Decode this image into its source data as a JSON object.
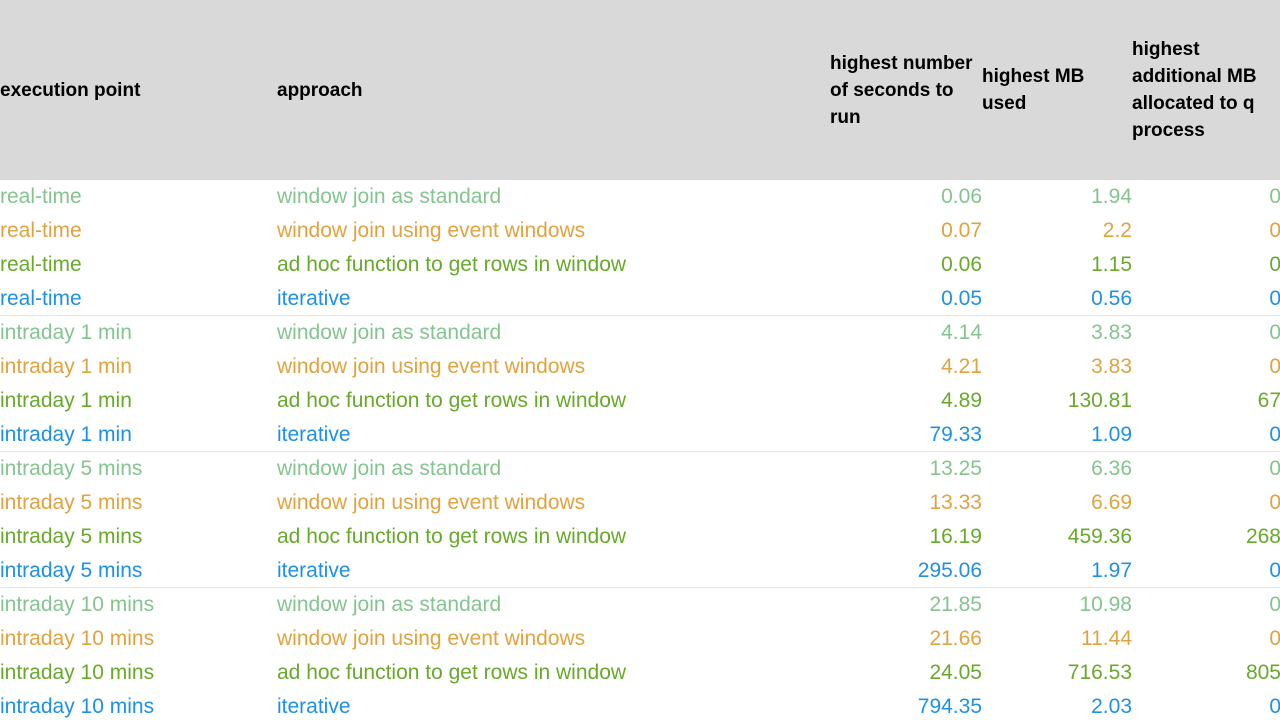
{
  "table": {
    "columns": [
      {
        "key": "execution_point",
        "label": "execution point",
        "align": "left"
      },
      {
        "key": "approach",
        "label": "approach",
        "align": "left"
      },
      {
        "key": "seconds",
        "label": "highest number of seconds to run",
        "align": "right"
      },
      {
        "key": "mb_used",
        "label": "highest MB used",
        "align": "right"
      },
      {
        "key": "mb_allocated",
        "label": "highest additional MB allocated to q process",
        "align": "right"
      }
    ],
    "header_background": "#d9d9d9",
    "header_text_color": "#000000",
    "row_background": "#ffffff",
    "separator_color": "#e6e6e6",
    "approach_colors": {
      "window join as standard": "#85c490",
      "window join using event windows": "#dfa33f",
      "ad hoc function to get rows in window": "#68a92c",
      "iterative": "#1f90e8"
    },
    "rows": [
      {
        "execution_point": "real-time",
        "approach": "window join as standard",
        "seconds": "0.06",
        "mb_used": "1.94",
        "mb_allocated": "0",
        "color_key": "k-standard",
        "group_end": false
      },
      {
        "execution_point": "real-time",
        "approach": "window join using event windows",
        "seconds": "0.07",
        "mb_used": "2.2",
        "mb_allocated": "0",
        "color_key": "k-event",
        "group_end": false
      },
      {
        "execution_point": "real-time",
        "approach": "ad hoc function to get rows in window",
        "seconds": "0.06",
        "mb_used": "1.15",
        "mb_allocated": "0",
        "color_key": "k-adhoc",
        "group_end": false
      },
      {
        "execution_point": "real-time",
        "approach": "iterative",
        "seconds": "0.05",
        "mb_used": "0.56",
        "mb_allocated": "0",
        "color_key": "k-iter",
        "group_end": true
      },
      {
        "execution_point": "intraday 1 min",
        "approach": "window join as standard",
        "seconds": "4.14",
        "mb_used": "3.83",
        "mb_allocated": "0",
        "color_key": "k-standard",
        "group_end": false
      },
      {
        "execution_point": "intraday 1 min",
        "approach": "window join using event windows",
        "seconds": "4.21",
        "mb_used": "3.83",
        "mb_allocated": "0",
        "color_key": "k-event",
        "group_end": false
      },
      {
        "execution_point": "intraday 1 min",
        "approach": "ad hoc function to get rows in window",
        "seconds": "4.89",
        "mb_used": "130.81",
        "mb_allocated": "67",
        "color_key": "k-adhoc",
        "group_end": false
      },
      {
        "execution_point": "intraday 1 min",
        "approach": "iterative",
        "seconds": "79.33",
        "mb_used": "1.09",
        "mb_allocated": "0",
        "color_key": "k-iter",
        "group_end": true
      },
      {
        "execution_point": "intraday 5 mins",
        "approach": "window join as standard",
        "seconds": "13.25",
        "mb_used": "6.36",
        "mb_allocated": "0",
        "color_key": "k-standard",
        "group_end": false
      },
      {
        "execution_point": "intraday 5 mins",
        "approach": "window join using event windows",
        "seconds": "13.33",
        "mb_used": "6.69",
        "mb_allocated": "0",
        "color_key": "k-event",
        "group_end": false
      },
      {
        "execution_point": "intraday 5 mins",
        "approach": "ad hoc function to get rows in window",
        "seconds": "16.19",
        "mb_used": "459.36",
        "mb_allocated": "268",
        "color_key": "k-adhoc",
        "group_end": false
      },
      {
        "execution_point": "intraday 5 mins",
        "approach": "iterative",
        "seconds": "295.06",
        "mb_used": "1.97",
        "mb_allocated": "0",
        "color_key": "k-iter",
        "group_end": true
      },
      {
        "execution_point": "intraday 10 mins",
        "approach": "window join as standard",
        "seconds": "21.85",
        "mb_used": "10.98",
        "mb_allocated": "0",
        "color_key": "k-standard",
        "group_end": false
      },
      {
        "execution_point": "intraday 10 mins",
        "approach": "window join using event windows",
        "seconds": "21.66",
        "mb_used": "11.44",
        "mb_allocated": "0",
        "color_key": "k-event",
        "group_end": false
      },
      {
        "execution_point": "intraday 10 mins",
        "approach": "ad hoc function to get rows in window",
        "seconds": "24.05",
        "mb_used": "716.53",
        "mb_allocated": "805",
        "color_key": "k-adhoc",
        "group_end": false
      },
      {
        "execution_point": "intraday 10 mins",
        "approach": "iterative",
        "seconds": "794.35",
        "mb_used": "2.03",
        "mb_allocated": "0",
        "color_key": "k-iter",
        "group_end": true
      }
    ]
  },
  "chart_data": {
    "type": "table",
    "title": "",
    "columns": [
      "execution point",
      "approach",
      "highest number of seconds to run",
      "highest MB used",
      "highest additional MB allocated to q process"
    ],
    "categories": [
      "real-time",
      "intraday 1 min",
      "intraday 5 mins",
      "intraday 10 mins"
    ],
    "series": [
      {
        "name": "window join as standard",
        "color": "#85c490",
        "seconds": [
          0.06,
          4.14,
          13.25,
          21.85
        ],
        "mb_used": [
          1.94,
          3.83,
          6.36,
          10.98
        ],
        "mb_allocated": [
          0,
          0,
          0,
          0
        ]
      },
      {
        "name": "window join using event windows",
        "color": "#dfa33f",
        "seconds": [
          0.07,
          4.21,
          13.33,
          21.66
        ],
        "mb_used": [
          2.2,
          3.83,
          6.69,
          11.44
        ],
        "mb_allocated": [
          0,
          0,
          0,
          0
        ]
      },
      {
        "name": "ad hoc function to get rows in window",
        "color": "#68a92c",
        "seconds": [
          0.06,
          4.89,
          16.19,
          24.05
        ],
        "mb_used": [
          1.15,
          130.81,
          459.36,
          716.53
        ],
        "mb_allocated": [
          0,
          67,
          268,
          805
        ]
      },
      {
        "name": "iterative",
        "color": "#1f90e8",
        "seconds": [
          0.05,
          79.33,
          295.06,
          794.35
        ],
        "mb_used": [
          0.56,
          1.09,
          1.97,
          2.03
        ],
        "mb_allocated": [
          0,
          0,
          0,
          0
        ]
      }
    ]
  }
}
